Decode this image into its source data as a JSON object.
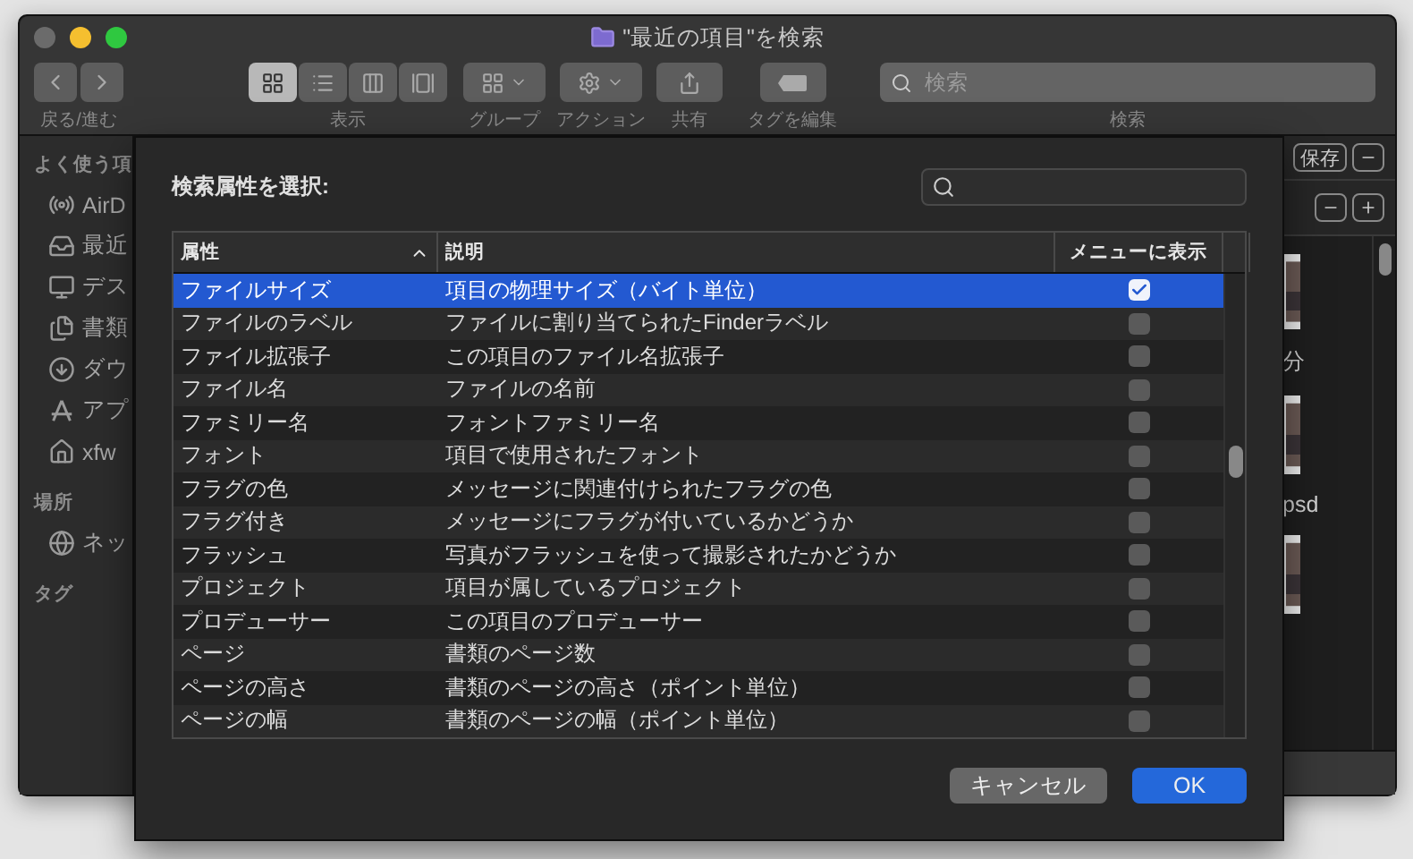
{
  "window": {
    "title": "\"最近の項目\"を検索"
  },
  "toolbar": {
    "nav_label": "戻る/進む",
    "view": {
      "label": "表示",
      "modes": [
        {
          "selected": true
        },
        {
          "selected": false
        },
        {
          "selected": false
        },
        {
          "selected": false
        }
      ]
    },
    "group_label": "グループ",
    "action_label": "アクション",
    "share_label": "共有",
    "tags_label": "タグを編集",
    "search": {
      "placeholder": "検索",
      "label": "検索"
    }
  },
  "sidebar": {
    "sections": [
      {
        "title": "よく使う項",
        "items": [
          {
            "kind": "airdrop",
            "label": "AirD"
          },
          {
            "kind": "recents",
            "label": "最近"
          },
          {
            "kind": "desktop",
            "label": "デス"
          },
          {
            "kind": "documents",
            "label": "書類"
          },
          {
            "kind": "downloads",
            "label": "ダウ"
          },
          {
            "kind": "apps",
            "label": "アプ"
          },
          {
            "kind": "home",
            "label": "xfw"
          }
        ]
      },
      {
        "title": "場所",
        "items": [
          {
            "kind": "network",
            "label": "ネッ"
          }
        ]
      },
      {
        "title": "タグ"
      }
    ]
  },
  "results": {
    "save_button": "保存",
    "files": [
      {
        "name": "分"
      },
      {
        "name": "psd"
      }
    ]
  },
  "sheet": {
    "title": "検索属性を選択:",
    "columns": [
      {
        "label": "属性",
        "sorted": true
      },
      {
        "label": "説明",
        "sorted": false
      },
      {
        "label": "メニューに表示",
        "sorted": false
      }
    ],
    "rows": [
      {
        "name": "ファイルサイズ",
        "description": "項目の物理サイズ（バイト単位）",
        "checked": true,
        "selected": true
      },
      {
        "name": "ファイルのラベル",
        "description": "ファイルに割り当てられたFinderラベル",
        "checked": false,
        "selected": false
      },
      {
        "name": "ファイル拡張子",
        "description": "この項目のファイル名拡張子",
        "checked": false,
        "selected": false
      },
      {
        "name": "ファイル名",
        "description": "ファイルの名前",
        "checked": false,
        "selected": false
      },
      {
        "name": "ファミリー名",
        "description": "フォントファミリー名",
        "checked": false,
        "selected": false
      },
      {
        "name": "フォント",
        "description": "項目で使用されたフォント",
        "checked": false,
        "selected": false
      },
      {
        "name": "フラグの色",
        "description": "メッセージに関連付けられたフラグの色",
        "checked": false,
        "selected": false
      },
      {
        "name": "フラグ付き",
        "description": "メッセージにフラグが付いているかどうか",
        "checked": false,
        "selected": false
      },
      {
        "name": "フラッシュ",
        "description": "写真がフラッシュを使って撮影されたかどうか",
        "checked": false,
        "selected": false
      },
      {
        "name": "プロジェクト",
        "description": "項目が属しているプロジェクト",
        "checked": false,
        "selected": false
      },
      {
        "name": "プロデューサー",
        "description": "この項目のプロデューサー",
        "checked": false,
        "selected": false
      },
      {
        "name": "ページ",
        "description": "書類のページ数",
        "checked": false,
        "selected": false
      },
      {
        "name": "ページの高さ",
        "description": "書類のページの高さ（ポイント単位）",
        "checked": false,
        "selected": false
      },
      {
        "name": "ページの幅",
        "description": "書類のページの幅（ポイント単位）",
        "checked": false,
        "selected": false
      }
    ],
    "buttons": [
      {
        "kind": "cancel",
        "label": "キャンセル"
      },
      {
        "kind": "default",
        "label": "OK"
      }
    ]
  }
}
